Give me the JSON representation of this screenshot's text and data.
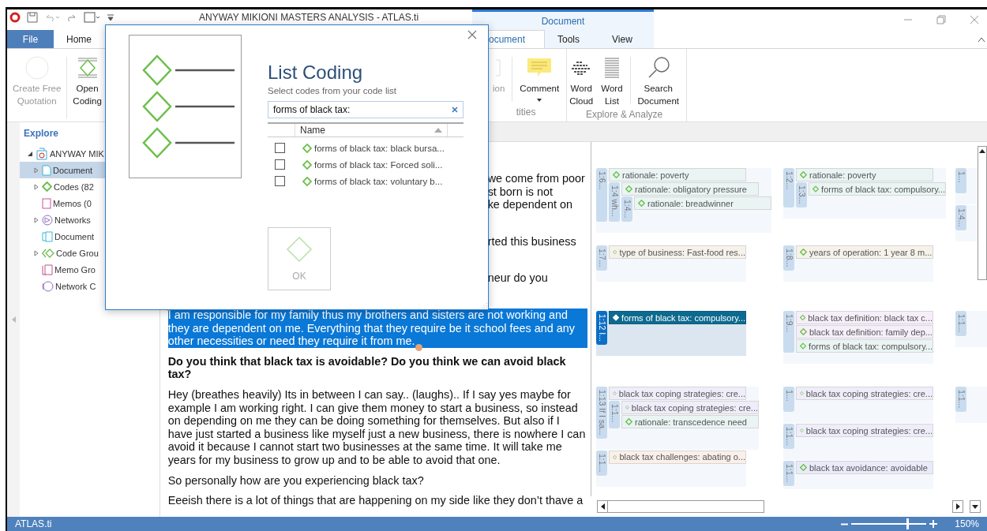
{
  "window": {
    "title": "ANYWAY MIKIONI MASTERS ANALYSIS - ATLAS.ti",
    "context_header": "Document"
  },
  "tabs": [
    {
      "label": "File",
      "kind": "file",
      "selected": false
    },
    {
      "label": "Home",
      "kind": "tab",
      "selected": false
    },
    {
      "label": "ocument",
      "kind": "context",
      "selected": true
    },
    {
      "label": "Tools",
      "kind": "context",
      "selected": false
    },
    {
      "label": "View",
      "kind": "context",
      "selected": false
    }
  ],
  "ribbon_left": [
    {
      "kind": "quotation",
      "lines": [
        "Create Free",
        "Quotation"
      ],
      "disabled": true
    },
    {
      "kind": "open-coding",
      "lines": [
        "Open",
        "Coding"
      ],
      "disabled": false
    }
  ],
  "ribbon_right": [
    {
      "label": "tities",
      "buttons": [
        {
          "kind": "partial",
          "lines": [
            "ion"
          ],
          "disabled": true,
          "dropdown": false
        },
        {
          "kind": "comment",
          "lines": [
            "Comment"
          ],
          "disabled": false,
          "dropdown": true
        }
      ]
    },
    {
      "label": "Explore & Analyze",
      "buttons": [
        {
          "kind": "word-cloud",
          "lines": [
            "Word",
            "Cloud"
          ],
          "disabled": false,
          "dropdown": false
        },
        {
          "kind": "word-list",
          "lines": [
            "Word",
            "List"
          ],
          "disabled": false,
          "dropdown": false
        },
        {
          "kind": "search",
          "lines": [
            "Search",
            "Document"
          ],
          "disabled": false,
          "dropdown": false
        }
      ]
    }
  ],
  "explore": {
    "title": "Explore",
    "root": {
      "label": "ANYWAY MIK",
      "expanded": true,
      "children": [
        {
          "label": "Document",
          "kind": "documents",
          "expanded": false,
          "selected": true
        },
        {
          "label": "Codes (82",
          "kind": "codes",
          "expanded": false,
          "selected": false
        },
        {
          "label": "Memos (0",
          "kind": "memos",
          "selected": false
        },
        {
          "label": "Networks",
          "kind": "networks",
          "expanded": false,
          "selected": false
        },
        {
          "label": "Document",
          "kind": "document-groups",
          "selected": false
        },
        {
          "label": "Code Grou",
          "kind": "code-groups",
          "expanded": false,
          "selected": false
        },
        {
          "label": "Memo Gro",
          "kind": "memo-groups",
          "selected": false
        },
        {
          "label": "Network C",
          "kind": "network-groups",
          "selected": false
        }
      ]
    }
  },
  "dialog": {
    "title": "List Coding",
    "subtitle": "Select codes from your code list",
    "search": {
      "value": "forms of black tax:"
    },
    "column": "Name",
    "items": [
      {
        "label": "forms of black tax: black bursa...",
        "checked": false
      },
      {
        "label": "forms of black tax: Forced soli...",
        "checked": false
      },
      {
        "label": "forms of black tax: voluntary b...",
        "checked": false
      }
    ],
    "ok": {
      "label": "OK",
      "disabled": true
    }
  },
  "document": {
    "paragraphs": [
      {
        "kind": "clipped",
        "lines": [
          "we come from poor",
          "st born is not",
          "ke dependent on"
        ]
      },
      {
        "kind": "clipped",
        "lines": [
          "rted this business"
        ]
      },
      {
        "kind": "clipped",
        "lines": [
          "neur do you"
        ]
      },
      {
        "kind": "answer",
        "selected": true,
        "text": "I am responsible for my family thus my brothers and sisters are not working and they are dependent on me. Everything that they require be it school fees and any other necessities or need they require it from me."
      },
      {
        "kind": "question",
        "selected": false,
        "text": "Do you think that black tax is avoidable? Do you think we can avoid black tax?"
      },
      {
        "kind": "answer",
        "selected": false,
        "text": "Hey (breathes heavily) Its in between I can say.. (laughs).. If I say yes maybe for example I am working right. I can give them money to start a business, so instead on depending on me they can be doing something for themselves. But also if I have just started a business like myself just a new business, there is nowhere I can avoid it because I cannot start two businesses at the same time. It will take me years for my business to grow up and to be able to avoid that one."
      },
      {
        "kind": "answer",
        "selected": false,
        "text": "So personally how are you experiencing black tax?"
      },
      {
        "kind": "answer",
        "selected": false,
        "text": "Eeeish there is a lot of things that are happening on my side like they don’t thave a"
      }
    ]
  },
  "margin": {
    "rows": [
      {
        "columns": [
          [
            {
              "tag": "1:6...",
              "selected": false,
              "codes": [
                {
                  "label": "rationale: poverty",
                  "color": "#e9f4f3"
                }
              ],
              "children": [
                {
                  "tag": "1:4 wh...",
                  "selected": false,
                  "codes": [
                    {
                      "label": "rationale: obligatory pressure",
                      "color": "#e9f4f3"
                    }
                  ],
                  "children": [
                    {
                      "tag": "1:4...",
                      "selected": false,
                      "codes": [
                        {
                          "label": "rationale: breadwinner",
                          "color": "#e9f4f3"
                        }
                      ]
                    }
                  ]
                }
              ]
            }
          ],
          [
            {
              "tag": "1:2...",
              "selected": false,
              "codes": [
                {
                  "label": "rationale: poverty",
                  "color": "#e9f4f3"
                }
              ],
              "children": [
                {
                  "tag": "1:3...",
                  "selected": false,
                  "codes": [
                    {
                      "label": "forms of black tax: compulsory...",
                      "color": "#e9f4f3"
                    }
                  ]
                }
              ]
            }
          ],
          [
            {
              "tag": "1...",
              "selected": false
            },
            {
              "tag": "1:4...",
              "selected": false
            }
          ]
        ]
      },
      {
        "columns": [
          [
            {
              "tag": "1:7...",
              "selected": false,
              "codes": [
                {
                  "label": "type of business: Fast-food res...",
                  "color": "#f6f2ea"
                }
              ]
            }
          ],
          [
            {
              "tag": "1:8...",
              "selected": false,
              "codes": [
                {
                  "label": "years of operation: 1 year 8 m...",
                  "color": "#f6f2ea"
                }
              ]
            }
          ],
          []
        ]
      },
      {
        "columns": [
          [
            {
              "tag": "1:12 I...",
              "selected": true,
              "codes": [
                {
                  "label": "forms of black tax: compulsory...",
                  "color": "#0d6a8f"
                }
              ]
            }
          ],
          [
            {
              "tag": "1:9...",
              "selected": false,
              "codes": [
                {
                  "label": "black tax definition: black tax c...",
                  "color": "#f6eefa"
                },
                {
                  "label": "black tax definition: family dep...",
                  "color": "#f6eefa"
                },
                {
                  "label": "forms of black tax: compulsory...",
                  "color": "#e9f4f3"
                }
              ]
            }
          ],
          [
            {
              "tag": "1:1...",
              "selected": false
            }
          ]
        ]
      },
      {
        "columns": [
          [
            {
              "tag": "1:13 If I sa...",
              "selected": false,
              "codes": [
                {
                  "label": "black tax coping strategies: cre...",
                  "color": "#efedfa"
                }
              ],
              "children": [
                {
                  "tag": "1:1...",
                  "selected": false,
                  "codes": [
                    {
                      "label": "black tax coping strategies: cre...",
                      "color": "#efedfa"
                    },
                    {
                      "label": "rationale: transcedence need",
                      "color": "#e9f4f3"
                    }
                  ]
                }
              ]
            },
            {
              "tag": "1:1...",
              "selected": false,
              "codes": [
                {
                  "label": "black tax challenges: abating o...",
                  "color": "#fbefe9"
                }
              ]
            }
          ],
          [
            {
              "tag": "1...",
              "selected": false,
              "codes": [
                {
                  "label": "black tax coping strategies: cre...",
                  "color": "#efedfa"
                }
              ]
            },
            {
              "tag": "1:1...",
              "selected": false,
              "codes": [
                {
                  "label": "black tax coping strategies: cre...",
                  "color": "#efedfa"
                }
              ]
            },
            {
              "tag": "1:1...",
              "selected": false,
              "codes": [
                {
                  "label": "black tax avoidance: avoidable",
                  "color": "#e9ebfb"
                }
              ]
            }
          ],
          [
            {
              "tag": "1:1...",
              "selected": false
            }
          ]
        ]
      }
    ]
  },
  "status_bar": {
    "app": "ATLAS.ti",
    "zoom": {
      "level": 0.73,
      "reading": "150%"
    }
  }
}
